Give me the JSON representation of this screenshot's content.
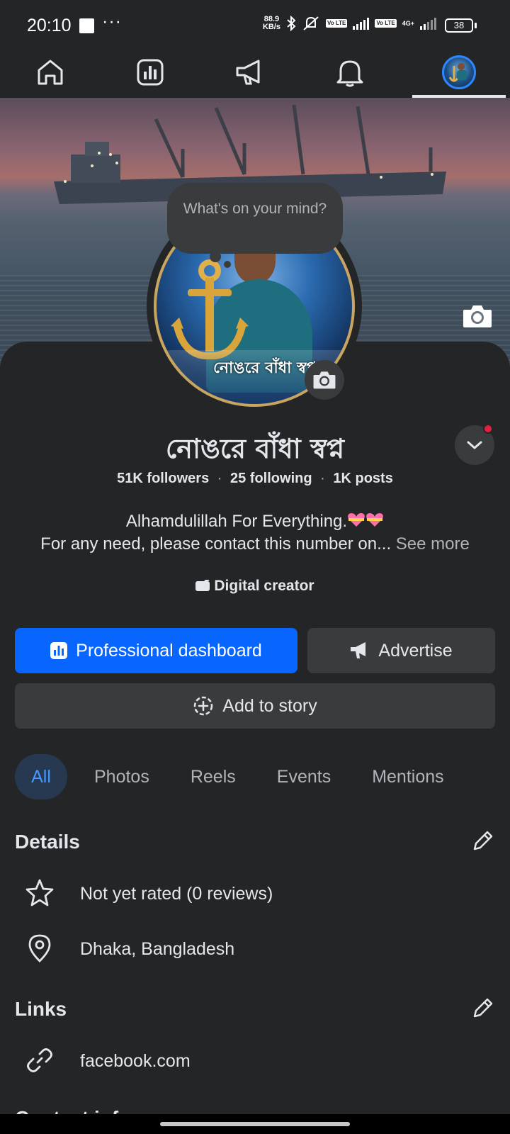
{
  "status_bar": {
    "time": "20:10",
    "dots": "···",
    "speed_value": "88.9",
    "speed_unit": "KB/s",
    "sim1_label": "Vo LTE",
    "sim2_label": "Vo LTE",
    "network_label": "4G+",
    "battery_level": "38"
  },
  "nav": {
    "items": [
      "home",
      "dashboard",
      "advertise",
      "notifications",
      "profile"
    ],
    "active": "profile"
  },
  "composer": {
    "prompt": "What's on your mind?"
  },
  "profile": {
    "name": "নোঙরে বাঁধা স্বপ্ন",
    "avatar_caption": "নোঙরে বাঁধা স্বপ্ন",
    "followers": "51K followers",
    "following": "25 following",
    "posts": "1K posts",
    "stat_separator": "·",
    "bio_line1": "Alhamdulillah For Everything.",
    "bio_line2": "For any need, please contact this number on...",
    "see_more": "See more",
    "category": "Digital creator"
  },
  "actions": {
    "professional_dashboard": "Professional dashboard",
    "advertise": "Advertise",
    "add_to_story": "Add to story"
  },
  "tabs": [
    {
      "label": "All",
      "active": true
    },
    {
      "label": "Photos",
      "active": false
    },
    {
      "label": "Reels",
      "active": false
    },
    {
      "label": "Events",
      "active": false
    },
    {
      "label": "Mentions",
      "active": false
    }
  ],
  "details": {
    "title": "Details",
    "rating": "Not yet rated (0 reviews)",
    "location": "Dhaka, Bangladesh"
  },
  "links": {
    "title": "Links",
    "url": "facebook.com"
  },
  "cutoff_section": {
    "title": "Contact info"
  },
  "colors": {
    "background": "#242526",
    "primary_button": "#0866ff",
    "secondary_button": "#3a3b3c",
    "active_tab_bg": "#263951",
    "active_tab_text": "#4599ff",
    "notification_dot": "#e41e3f"
  }
}
